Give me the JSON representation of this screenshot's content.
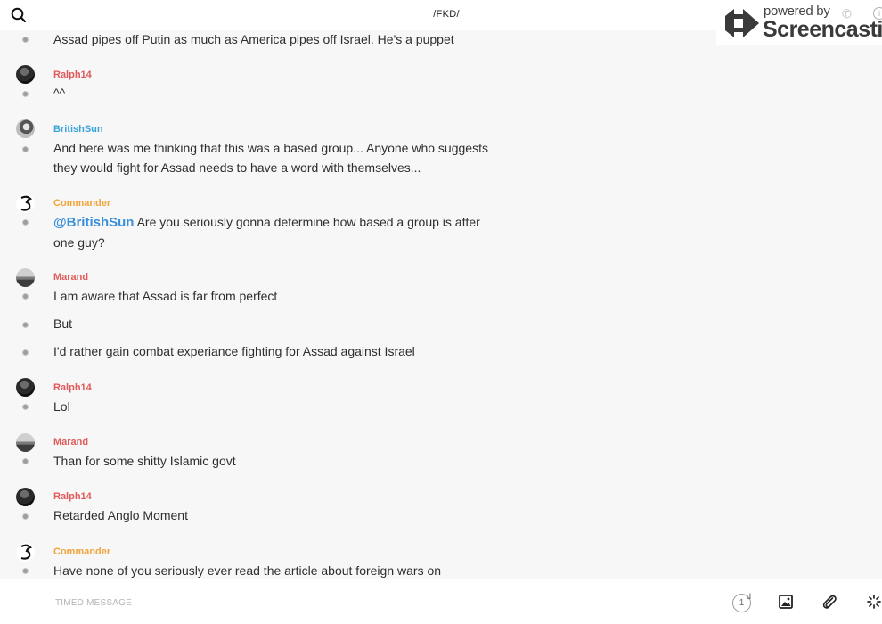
{
  "header": {
    "room_title": "/FKD/",
    "search_icon": "search-icon"
  },
  "watermark": {
    "powered_by": "powered by",
    "brand": "Screencastify"
  },
  "messages": [
    {
      "user": "",
      "text": "Assad pipes off Putin as much as America pipes off Israel. He's a puppet"
    },
    {
      "user": "Ralph14",
      "text": "^^"
    },
    {
      "user": "BritishSun",
      "text": "And here was me thinking that this was a based group... Anyone who suggests they would fight for Assad needs to have a word with themselves..."
    },
    {
      "user": "Commander",
      "mention": "@BritishSun",
      "text": " Are you seriously gonna determine how based a group is after one guy?"
    },
    {
      "user": "Marand",
      "text": "I am aware that Assad is far from perfect"
    },
    {
      "user": "",
      "text": "But"
    },
    {
      "user": "",
      "text": "I'd rather gain combat experiance fighting for Assad against Israel"
    },
    {
      "user": "Ralph14",
      "text": "Lol"
    },
    {
      "user": "Marand",
      "text": "Than for some shitty Islamic govt"
    },
    {
      "user": "Ralph14",
      "text": "Retarded Anglo Moment"
    },
    {
      "user": "Commander",
      "text": "Have none of you seriously ever read the article about foreign wars on"
    }
  ],
  "composer": {
    "placeholder": "TIMED MESSAGE",
    "timer_value": "1",
    "timer_unit": "d"
  },
  "toolbar_icons": [
    "image-icon",
    "paperclip-icon",
    "loading-spinner-icon"
  ],
  "colors": {
    "user_red": "#e05a5a",
    "user_blue": "#3aa3d8",
    "user_orange": "#f0a43a",
    "mention_blue": "#3a8fd8"
  }
}
